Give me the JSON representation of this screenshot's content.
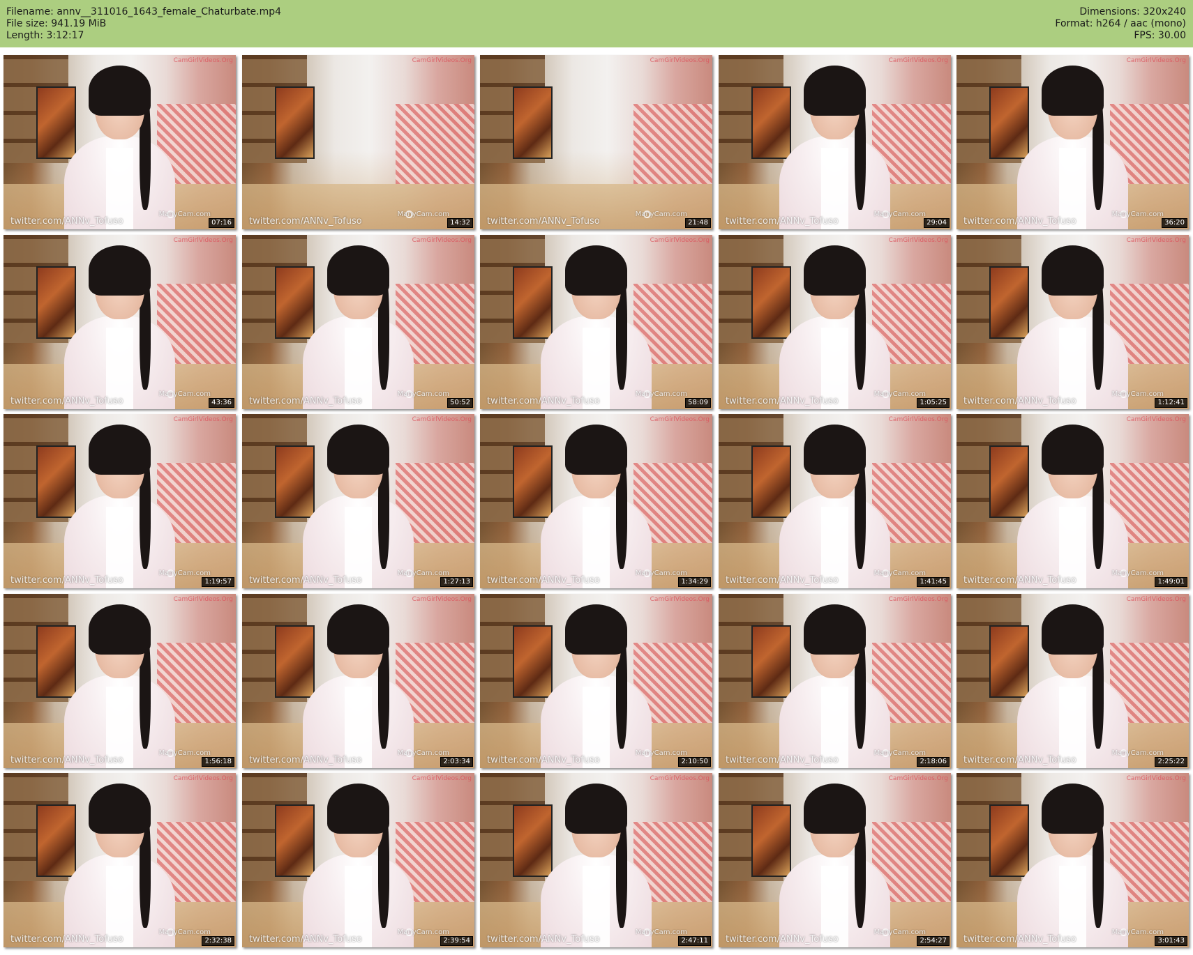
{
  "meta": {
    "filename_label": "Filename:",
    "filename": "annv__311016_1643_female_Chaturbate.mp4",
    "filesize_label": "File size:",
    "filesize": "941.19 MiB",
    "length_label": "Length:",
    "length": "3:12:17",
    "dimensions_label": "Dimensions:",
    "dimensions": "320x240",
    "format_label": "Format:",
    "format": "h264 / aac (mono)",
    "fps_label": "FPS:",
    "fps": "30.00"
  },
  "watermarks": {
    "top": "CamGirlVideos.Org",
    "bottom": "twitter.com/ANNv_Tofuso",
    "cam": "ManyCam.com"
  },
  "thumbnails": [
    {
      "time": "07:16"
    },
    {
      "time": "14:32"
    },
    {
      "time": "21:48"
    },
    {
      "time": "29:04"
    },
    {
      "time": "36:20"
    },
    {
      "time": "43:36"
    },
    {
      "time": "50:52"
    },
    {
      "time": "58:09"
    },
    {
      "time": "1:05:25"
    },
    {
      "time": "1:12:41"
    },
    {
      "time": "1:19:57"
    },
    {
      "time": "1:27:13"
    },
    {
      "time": "1:34:29"
    },
    {
      "time": "1:41:45"
    },
    {
      "time": "1:49:01"
    },
    {
      "time": "1:56:18"
    },
    {
      "time": "2:03:34"
    },
    {
      "time": "2:10:50"
    },
    {
      "time": "2:18:06"
    },
    {
      "time": "2:25:22"
    },
    {
      "time": "2:32:38"
    },
    {
      "time": "2:39:54"
    },
    {
      "time": "2:47:11"
    },
    {
      "time": "2:54:27"
    },
    {
      "time": "3:01:43"
    }
  ]
}
